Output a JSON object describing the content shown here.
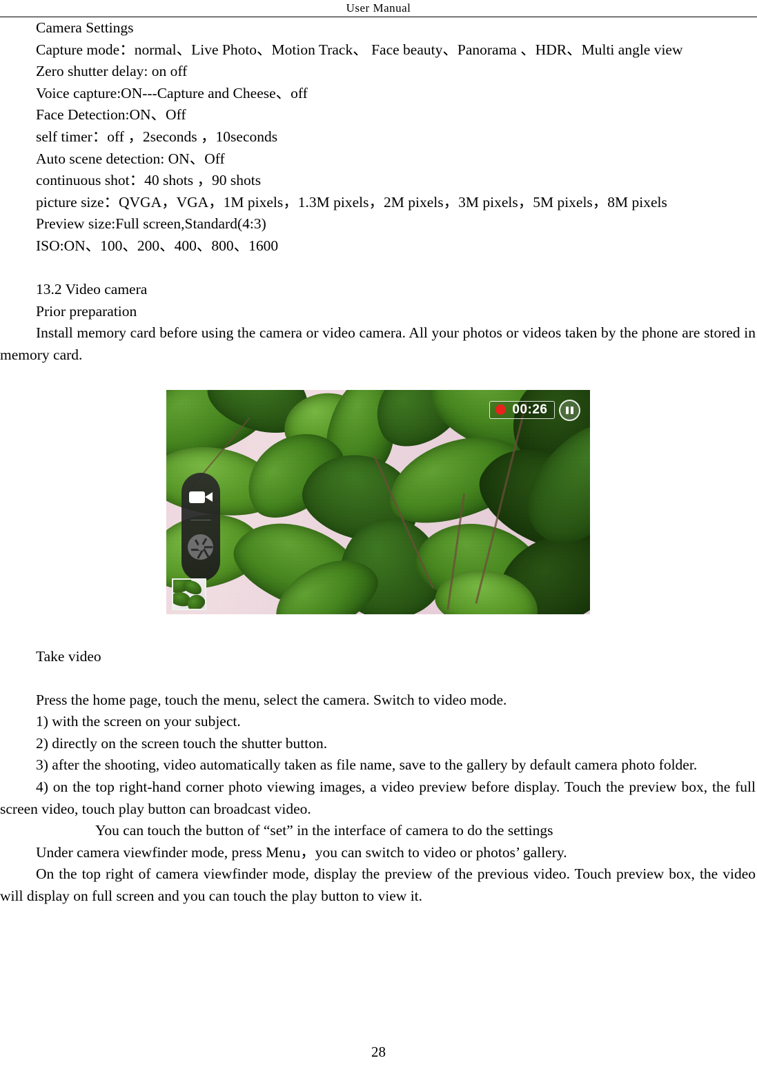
{
  "header": {
    "title": "User    Manual"
  },
  "document": {
    "section_heading": "Camera Settings",
    "settings_lines": [
      "Capture mode：normal、Live Photo、Motion Track、  Face beauty、Panorama   、HDR、Multi angle view",
      "Zero shutter delay: on    off",
      "Voice capture:ON---Capture and Cheese、off",
      "Face Detection:ON、Off",
      "self timer：off  ，2seconds  ，10seconds",
      "Auto scene detection: ON、Off",
      "continuous shot：40 shots  ，90 shots",
      "picture size：QVGA，VGA，1M pixels，1.3M pixels，2M pixels，3M pixels，5M pixels，8M pixels",
      "Preview size:Full screen,Standard(4:3)",
      "ISO:ON、100、200、400、800、1600"
    ],
    "subsection_number_title": "13.2    Video camera",
    "prior_preparation_heading": "Prior preparation",
    "prior_preparation_body": "Install memory card before using the camera or video camera. All your photos or videos taken by the phone are stored in memory card.",
    "take_video_heading": "Take video",
    "steps_intro": "Press the home page, touch the menu, select the camera. Switch to video mode.",
    "steps": [
      "1) with the screen on your subject.",
      "2) directly on the screen touch the shutter button.",
      "3) after the shooting, video automatically taken as file name, save to the gallery by default camera photo folder.",
      "4) on the top right-hand corner photo viewing images, a video preview before display. Touch the preview box, the full screen video, touch play button can broadcast video."
    ],
    "set_button_note": "You can touch the button of “set” in the interface of camera to do the settings",
    "menu_note": "Under camera viewfinder mode, press Menu，you can switch to video or photos’ gallery.",
    "preview_note": "On the top right of camera viewfinder mode, display the preview of the previous video. Touch preview box, the video will display on full screen and you can touch the play button to view it."
  },
  "figure": {
    "caption": "",
    "recording": {
      "timer": "00:26",
      "rec_dot_color": "#e8221c",
      "pause_label": "pause"
    },
    "mode_switch": {
      "video_mode_icon": "video-camera-icon",
      "shutter_icon": "shutter-aperture-icon"
    },
    "thumbnail_label": "last capture thumbnail"
  },
  "footer": {
    "page_number": "28"
  }
}
